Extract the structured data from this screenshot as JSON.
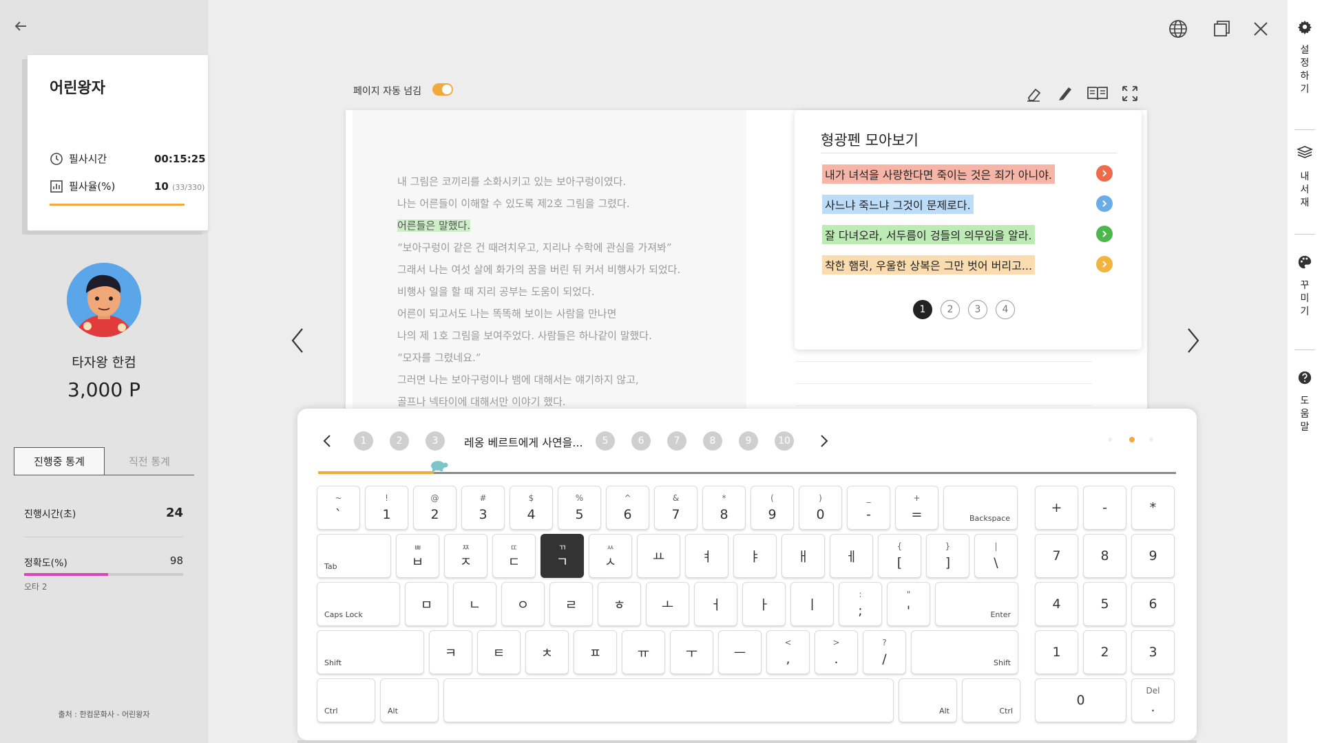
{
  "sidebar": {
    "book_title": "어린왕자",
    "time_label": "필사시간",
    "time_value": "00:15:25",
    "rate_label": "필사율(%)",
    "rate_value": "10",
    "rate_detail": "(33/330)",
    "user_name": "타자왕 한컴",
    "points": "3,000 P",
    "tabs": [
      "진행중 통계",
      "직전 통계"
    ],
    "progress_time_label": "진행시간(초)",
    "progress_time_value": "24",
    "accuracy_label": "정확도(%)",
    "accuracy_value": "98",
    "accuracy_fraction": 0.98,
    "typo": "오타 2",
    "source": "출처 : 한컴문화사 - 어린왕자"
  },
  "rail": {
    "items": [
      {
        "icon": "gear-icon",
        "label": "설정하기"
      },
      {
        "icon": "bookshelf-icon",
        "label": "내서재"
      },
      {
        "icon": "palette-icon",
        "label": "꾸미기"
      },
      {
        "icon": "help-icon",
        "label": "도움말"
      }
    ]
  },
  "toolbar": {
    "auto_flip_label": "페이지 자동 넘김",
    "auto_flip_on": true
  },
  "book": {
    "lines": [
      "내 그림은 코끼리를 소화시키고 있는 보아구렁이였다.",
      "나는 어른들이 이해할 수 있도록 제2호 그림을 그렸다.",
      "어른들은 말했다.",
      "“보아구렁이 같은 건 때려치우고, 지리나 수학에 관심을 가져봐”",
      "그래서 나는 여섯 살에 화가의 꿈을 버린 뒤 커서 비행사가 되었다.",
      "비행사 일을 할 때 지리 공부는 도움이 되었다.",
      "어른이 되고서도 나는 똑똑해 보이는 사람을 만나면",
      "나의 제 1호 그림을 보여주었다. 사람들은 하나같이 말했다.",
      "“모자를 그렸네요.”",
      "그러면 나는 보아구렁이나 뱀에 대해서는 얘기하지 않고,",
      "골프나 넥타이에 대해서만 이야기 했다."
    ],
    "highlighted_index": 2
  },
  "highlights": {
    "title": "형광펜 모아보기",
    "items": [
      {
        "text": "내가 녀석을 사랑한다면 죽이는 것은 죄가 아니야.",
        "color": "#f7b5a8",
        "dot": "#ee6a4a"
      },
      {
        "text": "사느냐 죽느냐 그것이 문제로다.",
        "color": "#bcdcf8",
        "dot": "#6aace8"
      },
      {
        "text": "잘 다녀오라, 서두름이 겅들의 의무임을 알라.",
        "color": "#bdeab5",
        "dot": "#4cb84c"
      },
      {
        "text": "착한 햄릿, 우울한 상복은 그만 벗어 버리고...",
        "color": "#fbdcb0",
        "dot": "#f2b43f"
      }
    ],
    "pages": [
      "1",
      "2",
      "3",
      "4"
    ],
    "current_page": "1"
  },
  "sentences": {
    "before": [
      "1",
      "2",
      "3"
    ],
    "current": "레옹 베르트에게 사연을...",
    "after": [
      "5",
      "6",
      "7",
      "8",
      "9",
      "10"
    ],
    "progress": 0.135
  },
  "keyboard": {
    "rows": [
      [
        [
          "~",
          "`"
        ],
        [
          "!",
          "1"
        ],
        [
          "@",
          "2"
        ],
        [
          "#",
          "3"
        ],
        [
          "$",
          "4"
        ],
        [
          "%",
          "5"
        ],
        [
          "^",
          "6"
        ],
        [
          "&",
          "7"
        ],
        [
          "*",
          "8"
        ],
        [
          "(",
          "9"
        ],
        [
          ")",
          "0"
        ],
        [
          "_",
          "-"
        ],
        [
          "+",
          "="
        ],
        [
          "",
          "Backspace"
        ]
      ],
      [
        [
          "",
          "Tab"
        ],
        [
          "ㅃ",
          "ㅂ"
        ],
        [
          "ㅉ",
          "ㅈ"
        ],
        [
          "ㄸ",
          "ㄷ"
        ],
        [
          "ㄲ",
          "ㄱ"
        ],
        [
          "ㅆ",
          "ㅅ"
        ],
        [
          "",
          "ㅛ"
        ],
        [
          "",
          "ㅕ"
        ],
        [
          "",
          "ㅑ"
        ],
        [
          "",
          "ㅐ"
        ],
        [
          "",
          "ㅔ"
        ],
        [
          "{",
          "["
        ],
        [
          "}",
          "]"
        ],
        [
          "|",
          "\\"
        ]
      ],
      [
        [
          "",
          "Caps Lock"
        ],
        [
          "",
          "ㅁ"
        ],
        [
          "",
          "ㄴ"
        ],
        [
          "",
          "ㅇ"
        ],
        [
          "",
          "ㄹ"
        ],
        [
          "",
          "ㅎ"
        ],
        [
          "",
          "ㅗ"
        ],
        [
          "",
          "ㅓ"
        ],
        [
          "",
          "ㅏ"
        ],
        [
          "",
          "ㅣ"
        ],
        [
          ":",
          ";"
        ],
        [
          "\"",
          "'"
        ],
        [
          "",
          "Enter"
        ]
      ],
      [
        [
          "",
          "Shift"
        ],
        [
          "",
          "ㅋ"
        ],
        [
          "",
          "ㅌ"
        ],
        [
          "",
          "ㅊ"
        ],
        [
          "",
          "ㅍ"
        ],
        [
          "",
          "ㅠ"
        ],
        [
          "",
          "ㅜ"
        ],
        [
          "",
          "ㅡ"
        ],
        [
          "<",
          ","
        ],
        [
          ">",
          "."
        ],
        [
          "?",
          "/"
        ],
        [
          "",
          "Shift"
        ]
      ],
      [
        [
          "",
          "Ctrl"
        ],
        [
          "",
          "Alt"
        ],
        [
          "",
          ""
        ],
        [
          "",
          "Alt"
        ],
        [
          "",
          "Ctrl"
        ]
      ]
    ],
    "numpad": [
      [
        "+",
        "-",
        "*"
      ],
      [
        "7",
        "8",
        "9"
      ],
      [
        "4",
        "5",
        "6"
      ],
      [
        "1",
        "2",
        "3"
      ]
    ],
    "numpad_zero": "0",
    "numpad_del": [
      "Del",
      "."
    ],
    "pressed": "ㄱ"
  },
  "colors": {
    "accent": "#f2a93b",
    "accuracy": "#e040b8"
  }
}
